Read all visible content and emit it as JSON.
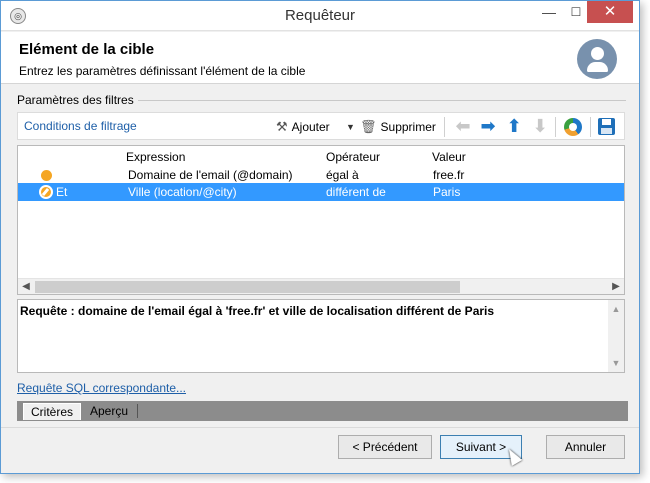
{
  "window": {
    "title": "Requêteur",
    "controls": {
      "minimize": "—",
      "maximize": "☐",
      "close": "✕"
    }
  },
  "header": {
    "title": "Elément de la cible",
    "subtitle": "Entrez les paramètres définissant l'élément de la cible",
    "avatar_icon": "user-avatar-icon"
  },
  "filters": {
    "group_label": "Paramètres des filtres",
    "section_title": "Conditions de filtrage",
    "toolbar": {
      "add_label": "Ajouter",
      "delete_label": "Supprimer",
      "icons": [
        "add-icon",
        "dropdown-icon",
        "trash-icon",
        "arrow-left-icon",
        "arrow-right-icon",
        "arrow-up-icon",
        "arrow-down-icon",
        "distribution-chart-icon",
        "save-icon"
      ]
    },
    "columns": [
      "Expression",
      "Opérateur",
      "Valeur"
    ],
    "rows": [
      {
        "connector": "",
        "expression": "Domaine de l'email (@domain)",
        "operator": "égal à",
        "value": "free.fr",
        "selected": false
      },
      {
        "connector": "Et",
        "expression": "Ville (location/@city)",
        "operator": "différent de",
        "value": "Paris",
        "selected": true
      }
    ],
    "selection_color": "#3399ff",
    "condition_icon_color": "#f5a623"
  },
  "query": {
    "text": "Requête : domaine de l'email égal à 'free.fr' et ville de localisation différent de Paris",
    "sql_link": "Requête SQL correspondante..."
  },
  "tabs": [
    "Critères",
    "Aperçu"
  ],
  "active_tab": "Critères",
  "buttons": {
    "prev": "< Précédent",
    "next": "Suivant >",
    "cancel": "Annuler"
  },
  "colors": {
    "accent": "#1e5fa8",
    "close_button": "#c75050"
  }
}
